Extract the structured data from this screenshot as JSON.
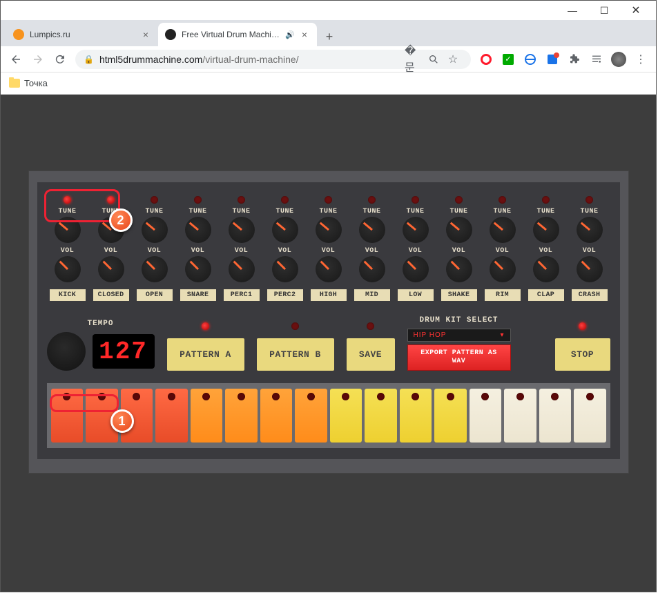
{
  "window": {
    "minimize": "—",
    "maximize": "☐",
    "close": "✕"
  },
  "tabs": [
    {
      "title": "Lumpics.ru",
      "active": false,
      "audio": false
    },
    {
      "title": "Free Virtual Drum Machine, L",
      "active": true,
      "audio": true
    }
  ],
  "toolbar": {
    "url_domain": "html5drummachine.com",
    "url_path": "/virtual-drum-machine/"
  },
  "bookmarks": [
    {
      "label": "Точка"
    }
  ],
  "machine": {
    "labels": {
      "tune": "TUNE",
      "vol": "VOL",
      "tempo": "TEMPO",
      "kit": "DRUM KIT SELECT"
    },
    "channels": [
      "KICK",
      "CLOSED",
      "OPEN",
      "SNARE",
      "PERC1",
      "PERC2",
      "HIGH",
      "MID",
      "LOW",
      "SHAKE",
      "RIM",
      "CLAP",
      "CRASH"
    ],
    "tempo_value": "127",
    "buttons": {
      "pattern_a": "PATTERN A",
      "pattern_b": "PATTERN B",
      "save": "SAVE",
      "export": "EXPORT PATTERN AS WAV",
      "stop": "STOP"
    },
    "kit_selected": "HIP HOP",
    "pads": [
      {
        "c": "red"
      },
      {
        "c": "red"
      },
      {
        "c": "red"
      },
      {
        "c": "red"
      },
      {
        "c": "orange"
      },
      {
        "c": "orange"
      },
      {
        "c": "orange"
      },
      {
        "c": "orange"
      },
      {
        "c": "yellow"
      },
      {
        "c": "yellow"
      },
      {
        "c": "yellow"
      },
      {
        "c": "yellow"
      },
      {
        "c": "white"
      },
      {
        "c": "white"
      },
      {
        "c": "white"
      },
      {
        "c": "white"
      }
    ]
  },
  "callouts": {
    "one": "1",
    "two": "2"
  }
}
